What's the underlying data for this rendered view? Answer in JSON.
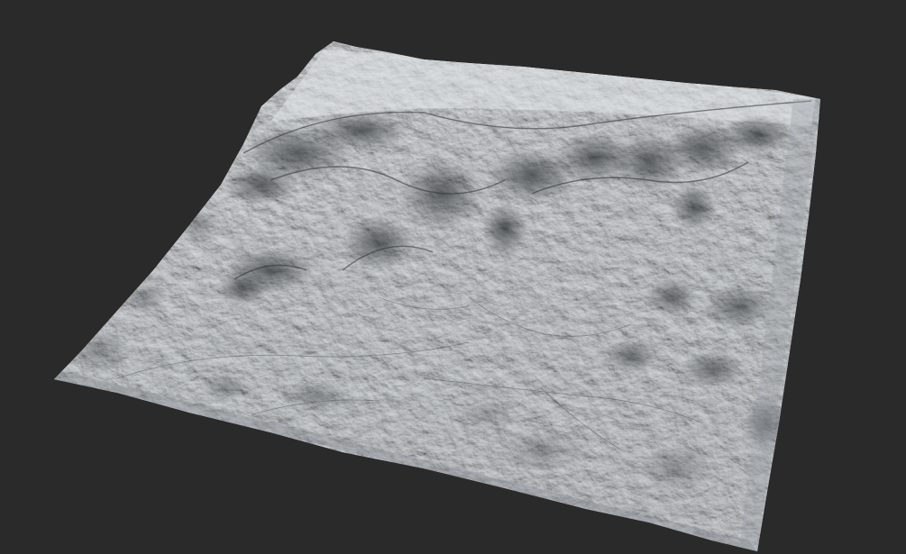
{
  "scene": {
    "background_color": "#2a2a2a",
    "terrain_base_color": "#c9ced3",
    "terrain_highlight_color": "#e6e9ec",
    "terrain_shadow_color": "#3e4349",
    "ridge_shadow_color": "#23272c"
  }
}
